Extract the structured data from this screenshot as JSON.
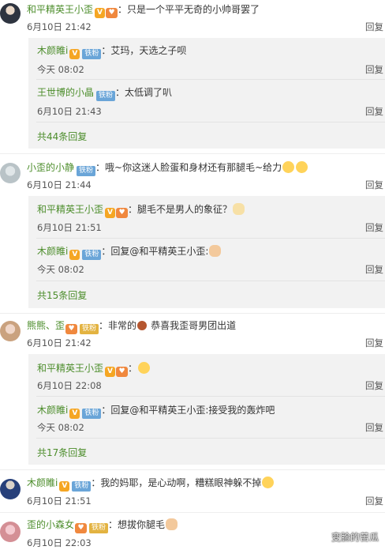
{
  "reply_label": "回复",
  "badges": {
    "v": "V",
    "heart": "♥",
    "fan": "铁粉",
    "fan_gold": "铁粉"
  },
  "comments": [
    {
      "user": "和平精英王小歪",
      "text": "只是一个平平无奇的小帅哥罢了",
      "time": "6月10日 21:42",
      "replies": [
        {
          "user": "木颜睢i",
          "text": "艾玛，天选之子呗",
          "time": "今天 08:02"
        },
        {
          "user": "王世博的小晶",
          "text": "太低调了叭",
          "time": "6月10日 21:43"
        }
      ],
      "more": "共44条回复"
    },
    {
      "user": "小歪的小静",
      "text": "哦~你这迷人脸蛋和身材还有那腿毛~给力",
      "time": "6月10日 21:44",
      "replies": [
        {
          "user": "和平精英王小歪",
          "text": "腿毛不是男人的象征？",
          "time": "6月10日 21:51"
        },
        {
          "user": "木颜睢i",
          "text": "回复@和平精英王小歪:",
          "time": "今天 08:02"
        }
      ],
      "more": "共15条回复"
    },
    {
      "user": "熊熊、歪",
      "text": "非常的",
      "text2": "恭喜我歪哥男团出道",
      "time": "6月10日 21:42",
      "replies": [
        {
          "user": "和平精英王小歪",
          "text": "",
          "time": "6月10日 22:08"
        },
        {
          "user": "木颜睢i",
          "text": "回复@和平精英王小歪:接受我的轰炸吧",
          "time": "今天 08:02"
        }
      ],
      "more": "共17条回复"
    },
    {
      "user": "木颜睢i",
      "text": "我的妈耶，是心动啊，糟糕眼神躲不掉",
      "time": "6月10日 21:51"
    },
    {
      "user": "歪的小森女",
      "text": "想拔你腿毛",
      "time": "6月10日 22:03"
    }
  ],
  "watermark": "变脸的苦瓜"
}
